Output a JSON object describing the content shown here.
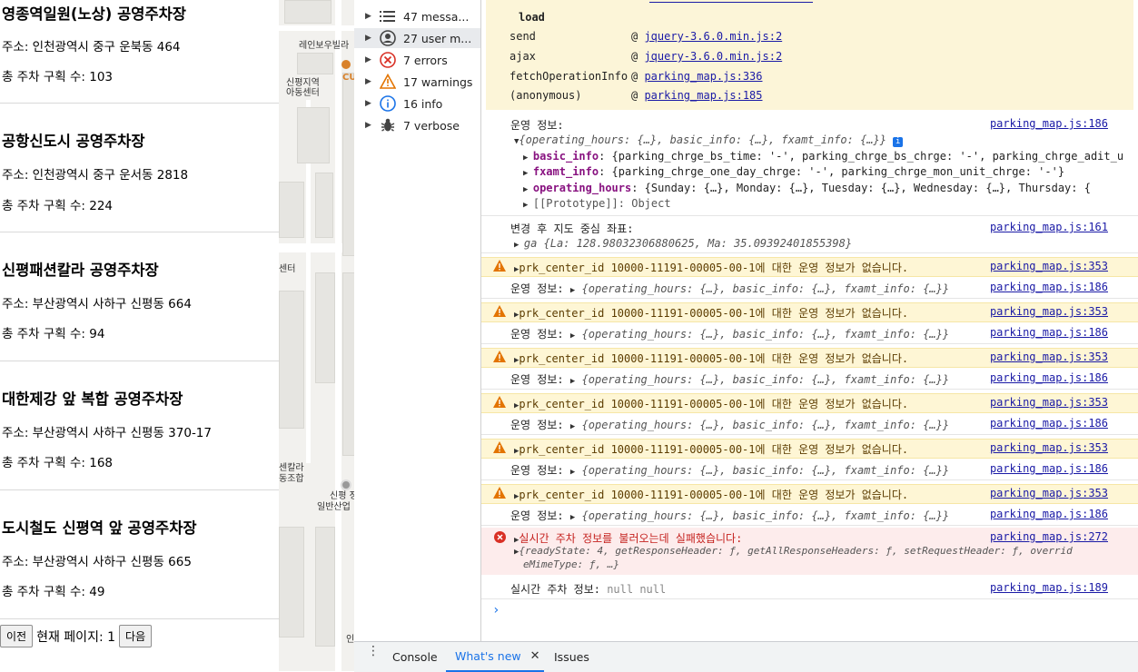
{
  "parking_lots": [
    {
      "name": "영종역일원(노상) 공영주차장",
      "address": "주소: 인천광역시 중구 운북동 464",
      "count": "총 주차 구획 수: 103"
    },
    {
      "name": "공항신도시 공영주차장",
      "address": "주소: 인천광역시 중구 운서동 2818",
      "count": "총 주차 구획 수: 224"
    },
    {
      "name": "신평패션칼라 공영주차장",
      "address": "주소: 부산광역시 사하구 신평동 664",
      "count": "총 주차 구획 수: 94"
    },
    {
      "name": "대한제강 앞 복합 공영주차장",
      "address": "주소: 부산광역시 사하구 신평동 370-17",
      "count": "총 주차 구획 수: 168"
    },
    {
      "name": "도시철도 신평역 앞 공영주차장",
      "address": "주소: 부산광역시 사하구 신평동 665",
      "count": "총 주차 구획 수: 49"
    }
  ],
  "pager": {
    "prev": "이전",
    "current": "현재 페이지: 1",
    "next": "다음"
  },
  "map": {
    "labels": [
      "레인보우빌라",
      "CU",
      "신평지역",
      "아동센터",
      "센터",
      "센칼라",
      "동조합",
      "신평 정",
      "일반산업",
      "인"
    ]
  },
  "sidebar": {
    "items": [
      {
        "label": "47 messa...",
        "icon": "list-icon"
      },
      {
        "label": "27 user m...",
        "icon": "user-icon"
      },
      {
        "label": "7 errors",
        "icon": "error-icon"
      },
      {
        "label": "17 warnings",
        "icon": "warning-icon"
      },
      {
        "label": "16 info",
        "icon": "info-icon"
      },
      {
        "label": "7 verbose",
        "icon": "bug-icon"
      }
    ]
  },
  "console": {
    "stack": {
      "load": "load",
      "rows": [
        {
          "fn": "send",
          "src": "jquery-3.6.0.min.js:2"
        },
        {
          "fn": "ajax",
          "src": "jquery-3.6.0.min.js:2"
        },
        {
          "fn": "fetchOperationInfo",
          "src": "parking_map.js:336"
        },
        {
          "fn": "(anonymous)",
          "src": "parking_map.js:185"
        }
      ]
    },
    "op_info_label": "운영 정보:",
    "op_info_src": "parking_map.js:186",
    "op_summary": "{operating_hours: {…}, basic_info: {…}, fxamt_info: {…}}",
    "basic_key": "basic_info",
    "basic_val": "{parking_chrge_bs_time: '-', parking_chrge_bs_chrge: '-', parking_chrge_adit_u",
    "fxamt_key": "fxamt_info",
    "fxamt_val": "{parking_chrge_one_day_chrge: '-', parking_chrge_mon_unit_chrge: '-'}",
    "hours_key": "operating_hours",
    "hours_val": "{Sunday: {…}, Monday: {…}, Tuesday: {…}, Wednesday: {…}, Thursday: {",
    "proto": "[[Prototype]]: Object",
    "center_label": "변경 후 지도 중심 좌표:",
    "center_src": "parking_map.js:161",
    "center_val": "ga {La: 128.98032306880625, Ma: 35.09392401855398}",
    "warn_text": "prk_center_id 10000-11191-00005-00-1에 대한 운영 정보가 없습니다.",
    "warn_src": "parking_map.js:353",
    "op_short": "{operating_hours: {…}, basic_info: {…}, fxamt_info: {…}}",
    "err_text": "실시간 주차 정보를 불러오는데 실패했습니다:",
    "err_src": "parking_map.js:272",
    "err_detail1": "{readyState: 4, getResponseHeader: ƒ, getAllResponseHeaders: ƒ, setRequestHeader: ƒ, overrid",
    "err_detail2": "eMimeType: ƒ, …}",
    "realtime_label": "실시간 주차 정보:",
    "realtime_val": "null null",
    "realtime_src": "parking_map.js:189",
    "prompt": "›"
  },
  "drawer": {
    "tabs": [
      "Console",
      "What's new",
      "Issues"
    ]
  },
  "colors": {
    "warning": "#e37400",
    "error": "#d93025",
    "link": "#1a1aa6"
  }
}
